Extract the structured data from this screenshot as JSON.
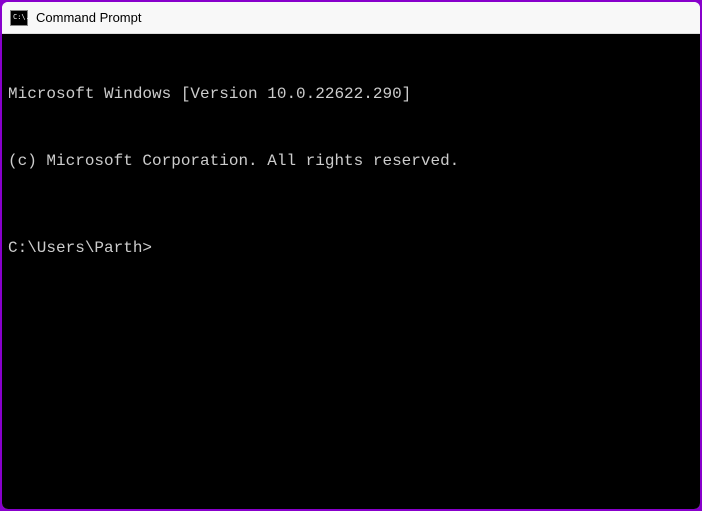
{
  "titlebar": {
    "title": "Command Prompt",
    "icon_text": "C:\\."
  },
  "terminal": {
    "line1": "Microsoft Windows [Version 10.0.22622.290]",
    "line2": "(c) Microsoft Corporation. All rights reserved.",
    "prompt": "C:\\Users\\Parth>"
  }
}
